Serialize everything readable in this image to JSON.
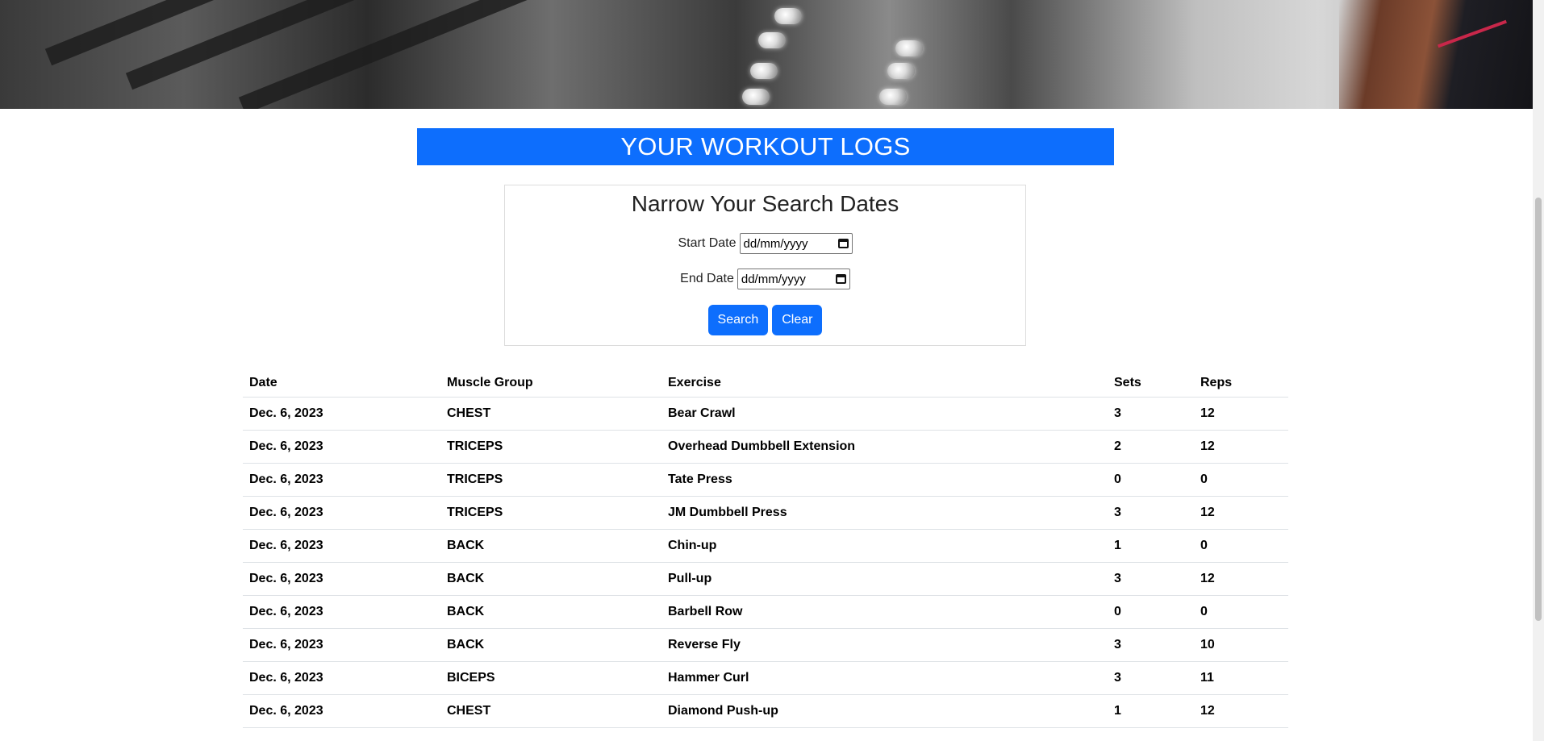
{
  "banner": {
    "title": "YOUR WORKOUT LOGS"
  },
  "search": {
    "heading": "Narrow Your Search Dates",
    "start_label": "Start Date",
    "start_placeholder": "dd/mm/yyyy",
    "end_label": "End Date",
    "end_placeholder": "dd/mm/yyyy",
    "search_button": "Search",
    "clear_button": "Clear"
  },
  "table": {
    "headers": [
      "Date",
      "Muscle Group",
      "Exercise",
      "Sets",
      "Reps"
    ],
    "rows": [
      [
        "Dec. 6, 2023",
        "CHEST",
        "Bear Crawl",
        "3",
        "12"
      ],
      [
        "Dec. 6, 2023",
        "TRICEPS",
        "Overhead Dumbbell Extension",
        "2",
        "12"
      ],
      [
        "Dec. 6, 2023",
        "TRICEPS",
        "Tate Press",
        "0",
        "0"
      ],
      [
        "Dec. 6, 2023",
        "TRICEPS",
        "JM Dumbbell Press",
        "3",
        "12"
      ],
      [
        "Dec. 6, 2023",
        "BACK",
        "Chin-up",
        "1",
        "0"
      ],
      [
        "Dec. 6, 2023",
        "BACK",
        "Pull-up",
        "3",
        "12"
      ],
      [
        "Dec. 6, 2023",
        "BACK",
        "Barbell Row",
        "0",
        "0"
      ],
      [
        "Dec. 6, 2023",
        "BACK",
        "Reverse Fly",
        "3",
        "10"
      ],
      [
        "Dec. 6, 2023",
        "BICEPS",
        "Hammer Curl",
        "3",
        "11"
      ],
      [
        "Dec. 6, 2023",
        "CHEST",
        "Diamond Push-up",
        "1",
        "12"
      ]
    ]
  },
  "colors": {
    "primary": "#0d6efd",
    "border": "#dee2e6"
  },
  "icons": {
    "date_picker": "calendar-icon"
  }
}
